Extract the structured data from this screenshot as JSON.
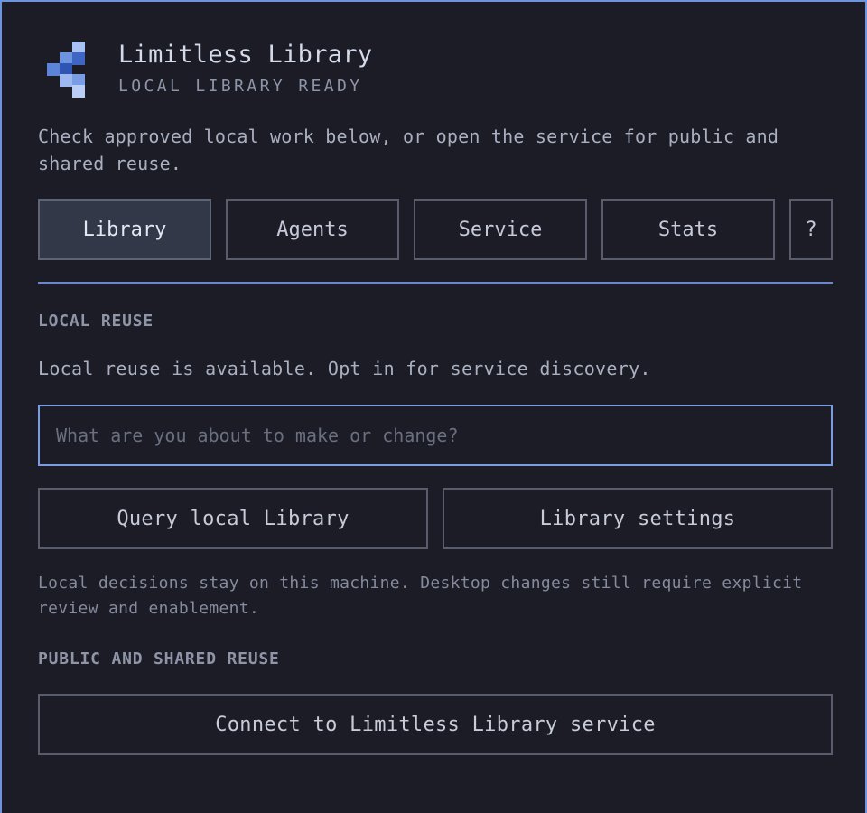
{
  "app": {
    "title": "Limitless Library",
    "status": "LOCAL LIBRARY READY",
    "logo_icon": "pixel-chevron-logo"
  },
  "intro": "Check approved local work below, or open the service for public and shared reuse.",
  "tabs": [
    {
      "label": "Library",
      "active": true
    },
    {
      "label": "Agents",
      "active": false
    },
    {
      "label": "Service",
      "active": false
    },
    {
      "label": "Stats",
      "active": false
    },
    {
      "label": "?",
      "active": false
    }
  ],
  "local_reuse": {
    "heading": "LOCAL REUSE",
    "status": "Local reuse is available. Opt in for service discovery.",
    "input_placeholder": "What are you about to make or change?",
    "input_value": "",
    "query_button": "Query local Library",
    "settings_button": "Library settings",
    "note": "Local decisions stay on this machine. Desktop changes still require explicit review and enablement."
  },
  "public_reuse": {
    "heading": "PUBLIC AND SHARED REUSE",
    "connect_button": "Connect to Limitless Library service"
  },
  "colors": {
    "background": "#1b1c26",
    "accent": "#6f93df",
    "active_tab": "#323848",
    "border": "#585c6b"
  }
}
